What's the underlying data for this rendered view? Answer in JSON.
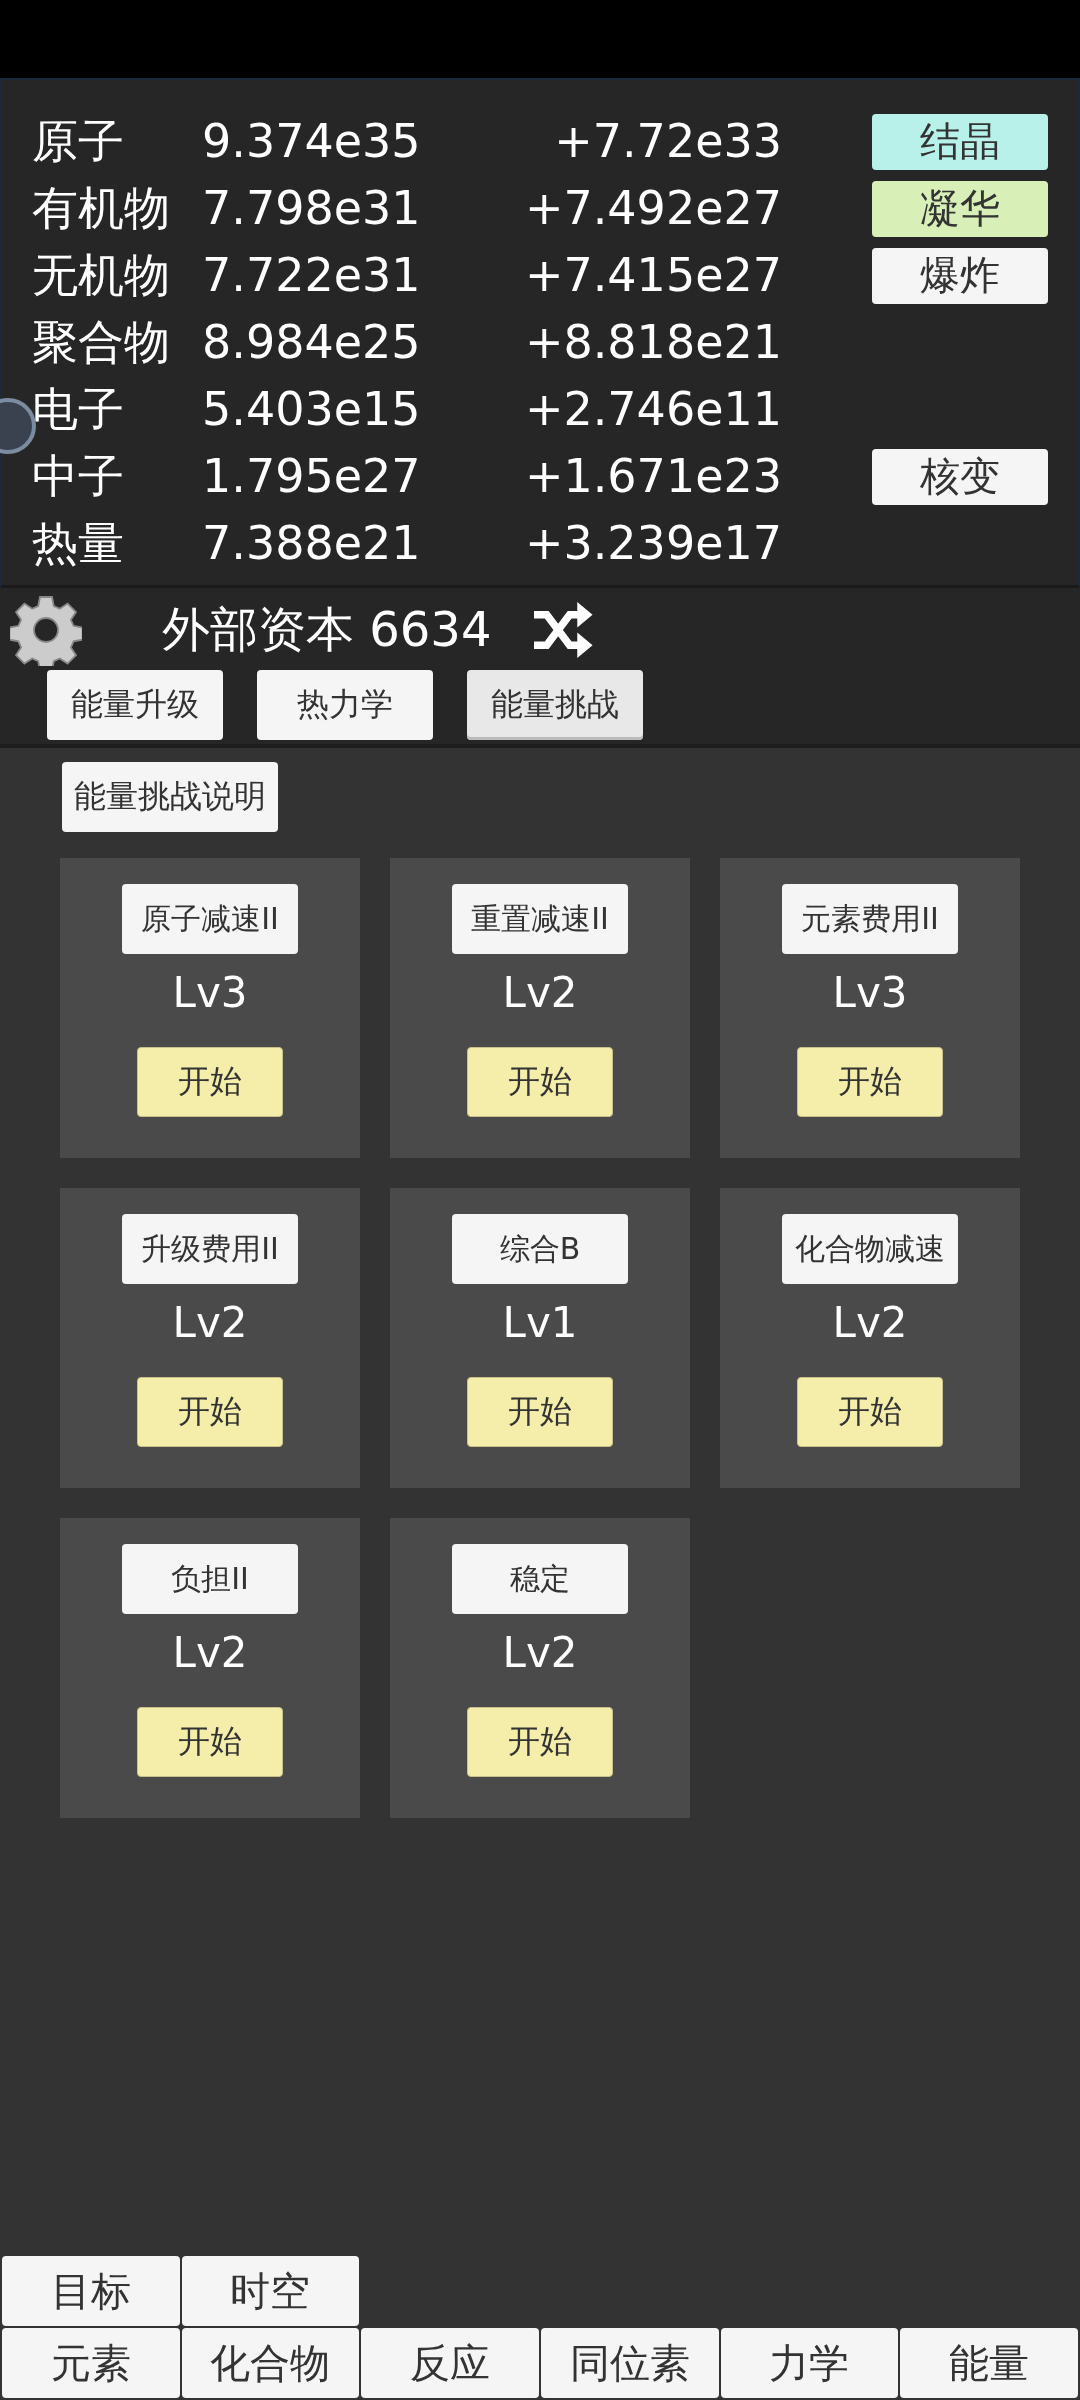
{
  "resources": [
    {
      "name": "原子",
      "amount": "9.374e35",
      "rate": "+7.72e33",
      "button": {
        "label": "结晶",
        "color": "#b8f0ea"
      }
    },
    {
      "name": "有机物",
      "amount": "7.798e31",
      "rate": "+7.492e27",
      "button": {
        "label": "凝华",
        "color": "#d8f0b8"
      }
    },
    {
      "name": "无机物",
      "amount": "7.722e31",
      "rate": "+7.415e27",
      "button": {
        "label": "爆炸",
        "color": "#f5f5f5"
      }
    },
    {
      "name": "聚合物",
      "amount": "8.984e25",
      "rate": "+8.818e21"
    },
    {
      "name": "电子",
      "amount": "5.403e15",
      "rate": "+2.746e11"
    },
    {
      "name": "中子",
      "amount": "1.795e27",
      "rate": "+1.671e23",
      "button": {
        "label": "核变",
        "color": "#f5f5f5"
      }
    },
    {
      "name": "热量",
      "amount": "7.388e21",
      "rate": "+3.239e17"
    }
  ],
  "capital": "外部资本 6634",
  "tabs": [
    {
      "label": "能量升级",
      "selected": false
    },
    {
      "label": "热力学",
      "selected": false
    },
    {
      "label": "能量挑战",
      "selected": true
    }
  ],
  "help_button": "能量挑战说明",
  "challenges": [
    {
      "name": "原子减速II",
      "level": "Lv3",
      "action": "开始"
    },
    {
      "name": "重置减速II",
      "level": "Lv2",
      "action": "开始"
    },
    {
      "name": "元素费用II",
      "level": "Lv3",
      "action": "开始"
    },
    {
      "name": "升级费用II",
      "level": "Lv2",
      "action": "开始"
    },
    {
      "name": "综合B",
      "level": "Lv1",
      "action": "开始"
    },
    {
      "name": "化合物减速",
      "level": "Lv2",
      "action": "开始"
    },
    {
      "name": "负担II",
      "level": "Lv2",
      "action": "开始"
    },
    {
      "name": "稳定",
      "level": "Lv2",
      "action": "开始"
    }
  ],
  "nav_top": [
    "目标",
    "时空"
  ],
  "nav_bottom": [
    "元素",
    "化合物",
    "反应",
    "同位素",
    "力学",
    "能量"
  ]
}
